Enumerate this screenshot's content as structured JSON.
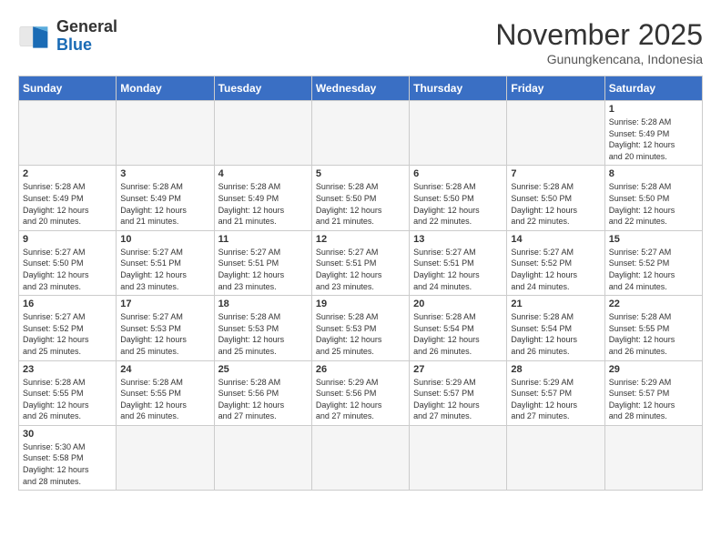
{
  "logo": {
    "text_general": "General",
    "text_blue": "Blue"
  },
  "title": "November 2025",
  "location": "Gunungkencana, Indonesia",
  "weekdays": [
    "Sunday",
    "Monday",
    "Tuesday",
    "Wednesday",
    "Thursday",
    "Friday",
    "Saturday"
  ],
  "days": [
    {
      "date": "",
      "info": ""
    },
    {
      "date": "",
      "info": ""
    },
    {
      "date": "",
      "info": ""
    },
    {
      "date": "",
      "info": ""
    },
    {
      "date": "",
      "info": ""
    },
    {
      "date": "",
      "info": ""
    },
    {
      "date": "1",
      "info": "Sunrise: 5:28 AM\nSunset: 5:49 PM\nDaylight: 12 hours\nand 20 minutes."
    },
    {
      "date": "2",
      "info": "Sunrise: 5:28 AM\nSunset: 5:49 PM\nDaylight: 12 hours\nand 20 minutes."
    },
    {
      "date": "3",
      "info": "Sunrise: 5:28 AM\nSunset: 5:49 PM\nDaylight: 12 hours\nand 21 minutes."
    },
    {
      "date": "4",
      "info": "Sunrise: 5:28 AM\nSunset: 5:49 PM\nDaylight: 12 hours\nand 21 minutes."
    },
    {
      "date": "5",
      "info": "Sunrise: 5:28 AM\nSunset: 5:50 PM\nDaylight: 12 hours\nand 21 minutes."
    },
    {
      "date": "6",
      "info": "Sunrise: 5:28 AM\nSunset: 5:50 PM\nDaylight: 12 hours\nand 22 minutes."
    },
    {
      "date": "7",
      "info": "Sunrise: 5:28 AM\nSunset: 5:50 PM\nDaylight: 12 hours\nand 22 minutes."
    },
    {
      "date": "8",
      "info": "Sunrise: 5:28 AM\nSunset: 5:50 PM\nDaylight: 12 hours\nand 22 minutes."
    },
    {
      "date": "9",
      "info": "Sunrise: 5:27 AM\nSunset: 5:50 PM\nDaylight: 12 hours\nand 23 minutes."
    },
    {
      "date": "10",
      "info": "Sunrise: 5:27 AM\nSunset: 5:51 PM\nDaylight: 12 hours\nand 23 minutes."
    },
    {
      "date": "11",
      "info": "Sunrise: 5:27 AM\nSunset: 5:51 PM\nDaylight: 12 hours\nand 23 minutes."
    },
    {
      "date": "12",
      "info": "Sunrise: 5:27 AM\nSunset: 5:51 PM\nDaylight: 12 hours\nand 23 minutes."
    },
    {
      "date": "13",
      "info": "Sunrise: 5:27 AM\nSunset: 5:51 PM\nDaylight: 12 hours\nand 24 minutes."
    },
    {
      "date": "14",
      "info": "Sunrise: 5:27 AM\nSunset: 5:52 PM\nDaylight: 12 hours\nand 24 minutes."
    },
    {
      "date": "15",
      "info": "Sunrise: 5:27 AM\nSunset: 5:52 PM\nDaylight: 12 hours\nand 24 minutes."
    },
    {
      "date": "16",
      "info": "Sunrise: 5:27 AM\nSunset: 5:52 PM\nDaylight: 12 hours\nand 25 minutes."
    },
    {
      "date": "17",
      "info": "Sunrise: 5:27 AM\nSunset: 5:53 PM\nDaylight: 12 hours\nand 25 minutes."
    },
    {
      "date": "18",
      "info": "Sunrise: 5:28 AM\nSunset: 5:53 PM\nDaylight: 12 hours\nand 25 minutes."
    },
    {
      "date": "19",
      "info": "Sunrise: 5:28 AM\nSunset: 5:53 PM\nDaylight: 12 hours\nand 25 minutes."
    },
    {
      "date": "20",
      "info": "Sunrise: 5:28 AM\nSunset: 5:54 PM\nDaylight: 12 hours\nand 26 minutes."
    },
    {
      "date": "21",
      "info": "Sunrise: 5:28 AM\nSunset: 5:54 PM\nDaylight: 12 hours\nand 26 minutes."
    },
    {
      "date": "22",
      "info": "Sunrise: 5:28 AM\nSunset: 5:55 PM\nDaylight: 12 hours\nand 26 minutes."
    },
    {
      "date": "23",
      "info": "Sunrise: 5:28 AM\nSunset: 5:55 PM\nDaylight: 12 hours\nand 26 minutes."
    },
    {
      "date": "24",
      "info": "Sunrise: 5:28 AM\nSunset: 5:55 PM\nDaylight: 12 hours\nand 26 minutes."
    },
    {
      "date": "25",
      "info": "Sunrise: 5:28 AM\nSunset: 5:56 PM\nDaylight: 12 hours\nand 27 minutes."
    },
    {
      "date": "26",
      "info": "Sunrise: 5:29 AM\nSunset: 5:56 PM\nDaylight: 12 hours\nand 27 minutes."
    },
    {
      "date": "27",
      "info": "Sunrise: 5:29 AM\nSunset: 5:57 PM\nDaylight: 12 hours\nand 27 minutes."
    },
    {
      "date": "28",
      "info": "Sunrise: 5:29 AM\nSunset: 5:57 PM\nDaylight: 12 hours\nand 27 minutes."
    },
    {
      "date": "29",
      "info": "Sunrise: 5:29 AM\nSunset: 5:57 PM\nDaylight: 12 hours\nand 28 minutes."
    },
    {
      "date": "30",
      "info": "Sunrise: 5:30 AM\nSunset: 5:58 PM\nDaylight: 12 hours\nand 28 minutes."
    },
    {
      "date": "",
      "info": ""
    },
    {
      "date": "",
      "info": ""
    },
    {
      "date": "",
      "info": ""
    },
    {
      "date": "",
      "info": ""
    },
    {
      "date": "",
      "info": ""
    },
    {
      "date": "",
      "info": ""
    }
  ]
}
